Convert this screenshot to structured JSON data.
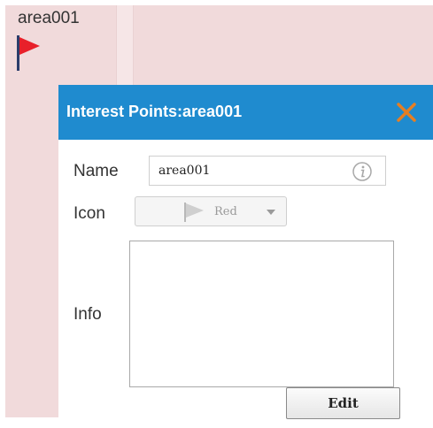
{
  "marker": {
    "label": "area001",
    "icon": "red-flag-icon"
  },
  "dialog": {
    "title": "Interest Points:area001",
    "close_icon": "close-icon",
    "header_color": "#1f8bcf",
    "close_color": "#e67e22",
    "fields": {
      "name_label": "Name",
      "name_value": "area001",
      "name_info_icon": "info-circle-icon",
      "icon_label": "Icon",
      "icon_selected": "Red",
      "icon_selected_icon": "flag-icon",
      "info_label": "Info",
      "info_value": ""
    },
    "edit_label": "Edit"
  }
}
